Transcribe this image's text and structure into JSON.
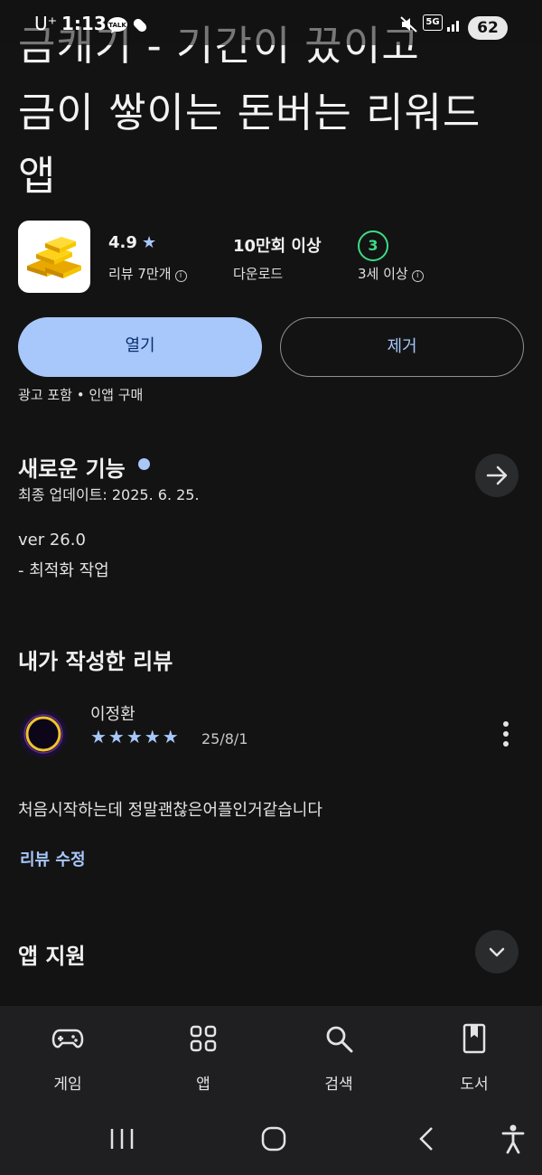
{
  "status_bar": {
    "carrier": "U⁺",
    "time": "1:13",
    "network": "5G",
    "battery": "62"
  },
  "app": {
    "title_lines": [
      "금캐기 - 기간이 끘이고",
      "금이 쌓이는 돈버는 리워드",
      "앱"
    ],
    "rating": "4.9",
    "reviews_label": "리뷰 7만개",
    "downloads_value": "10만회 이상",
    "downloads_label": "다운로드",
    "age_badge": "3",
    "age_label": "3세 이상",
    "open_button": "열기",
    "remove_button": "제거",
    "ads_note": "광고 포함 • 인앱 구매"
  },
  "whats_new": {
    "heading": "새로운 기능",
    "last_updated": "최종 업데이트: 2025. 6. 25.",
    "version": "ver 26.0",
    "note": "- 최적화 작업"
  },
  "my_review": {
    "heading": "내가 작성한 리뷰",
    "author": "이정환",
    "stars": 5,
    "date": "25/8/1",
    "text": "처음시작하는데 정말괜찮은어플인거같습니다",
    "edit_link": "리뷰 수정"
  },
  "app_support": {
    "heading": "앱 지원"
  },
  "bottom_nav": [
    {
      "label": "게임",
      "icon": "gamepad-icon"
    },
    {
      "label": "앱",
      "icon": "apps-grid-icon"
    },
    {
      "label": "검색",
      "icon": "search-icon"
    },
    {
      "label": "도서",
      "icon": "book-icon"
    }
  ],
  "colors": {
    "accent": "#a8c7fa",
    "background": "#131313",
    "badge_green": "#3ddc84"
  }
}
